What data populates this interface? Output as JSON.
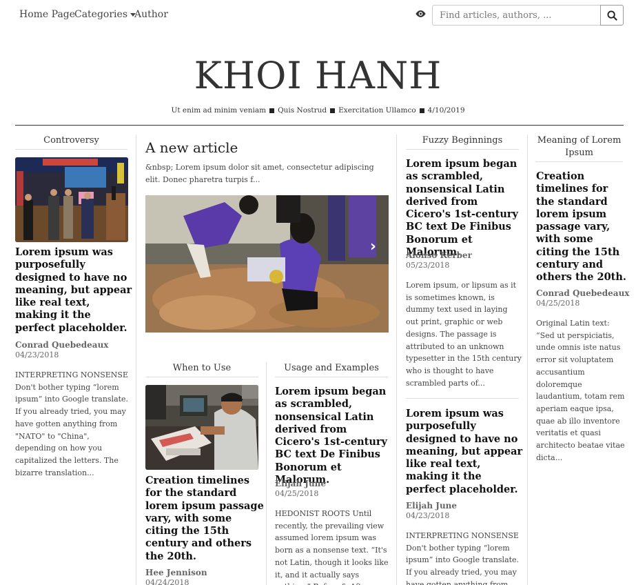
{
  "nav": {
    "home": "Home Page",
    "categories": "Categories",
    "author": "Author",
    "search_placeholder": "Find articles, authors, ..."
  },
  "masthead": {
    "logo": "KHOI HANH",
    "tags": [
      "Ut enim ad minim veniam",
      "Quis Nostrud",
      "Exercitation Ullamco",
      "4/10/2019"
    ]
  },
  "featured": {
    "title": "A new article",
    "lead": "&nbsp; Lorem ipsum dolor sit amet, consectetur adipiscing elit. Donec pharetra turpis f..."
  },
  "col1": {
    "section": "Controversy",
    "headline": "Lorem ipsum was purposefully designed to have no meaning, but appear like real text, making it the perfect placeholder.",
    "author": "Conrad Quebedeaux",
    "date": "04/23/2018",
    "excerpt": "INTERPRETING NONSENSE Don't bother typing “lorem ipsum” into Google translate. If you already tried, you may have gotten anything from \"NATO\" to \"China\", depending on how you capitalized the letters. The bizarre translation..."
  },
  "when": {
    "section": "When to Use",
    "headline": "Creation timelines for the standard lorem ipsum passage vary, with some citing the 15th century and others the 20th.",
    "author": "Hee Jennison",
    "date": "04/24/2018"
  },
  "usage": {
    "section": "Usage and Examples",
    "headline": "Lorem ipsum began as scrambled, nonsensical Latin derived from Cicero's 1st-century BC text De Finibus Bonorum et Malorum.",
    "author": "Elijah June",
    "date": "04/25/2018",
    "excerpt": "HEDONIST ROOTS Until recently, the prevailing view assumed lorem ipsum was born as a nonsense text. “It's not Latin, though it looks like it, and it actually says nothing,” Before & After..."
  },
  "fuzzy": {
    "section": "Fuzzy Beginnings",
    "headline": "Lorem ipsum began as scrambled, nonsensical Latin derived from Cicero's 1st-century BC text De Finibus Bonorum et Malorum.",
    "author": "Alonso Kerber",
    "date": "05/23/2018",
    "excerpt": "Lorem ipsum, or lipsum as it is sometimes known, is dummy text used in laying out print, graphic or web designs. The passage is attributed to an unknown typesetter in the 15th century who is thought to have scrambled parts of...",
    "headline2": "Lorem ipsum was purposefully designed to have no meaning, but appear like real text, making it the perfect placeholder.",
    "author2": "Elijah June",
    "date2": "04/23/2018",
    "excerpt2": "INTERPRETING NONSENSE Don't bother typing “lorem ipsum” into Google translate. If you already tried, you may have gotten anything from..."
  },
  "meaning": {
    "section": "Meaning of Lorem Ipsum",
    "headline": "Creation timelines for the standard lorem ipsum passage vary, with some citing the 15th century and others the 20th.",
    "author": "Conrad Quebedeaux",
    "date": "04/25/2018",
    "excerpt": "Original Latin text: “Sed ut perspiciatis, unde omnis iste natus error sit voluptatem accusantium doloremque laudantium, totam rem aperiam eaque ipsa, quae ab illo inventore veritatis et quasi architecto beatae vitae dicta..."
  },
  "icons": {
    "eye": "eye-icon",
    "search": "search-icon",
    "caret": "chevron-down-icon",
    "next": "chevron-right-icon"
  }
}
